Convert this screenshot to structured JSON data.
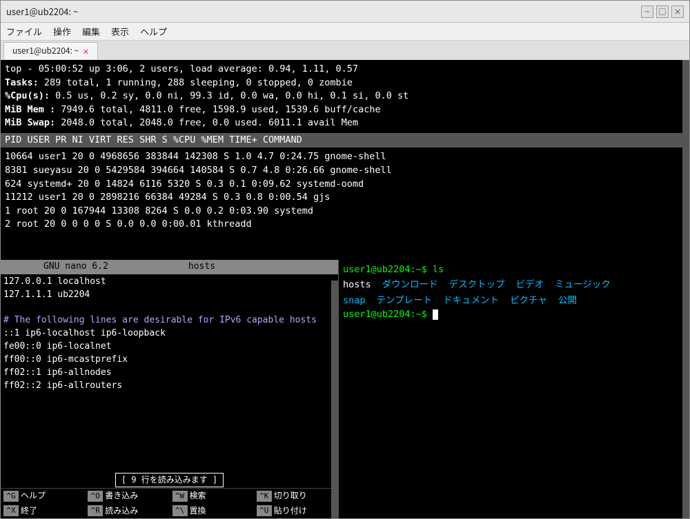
{
  "window": {
    "outer_title": "user1@ub2204: ~",
    "tab_title": "user1@ub2204: ~"
  },
  "menu": {
    "items": [
      "ファイル",
      "操作",
      "編集",
      "表示",
      "ヘルプ"
    ]
  },
  "top_output": {
    "line1": "top - 05:00:52 up  3:06,  2 users,  load average: 0.94, 1.11, 0.57",
    "line2_label": "Tasks:",
    "line2": " 289 total,   1 running, 288 sleeping,   0 stopped,   0 zombie",
    "line3_label": "%Cpu(s):",
    "line3": "  0.5 us,  0.2 sy,  0.0 ni, 99.3 id,  0.0 wa,  0.0 hi,  0.1 si,  0.0 st",
    "line4_label": "MiB Mem :",
    "line4": "  7949.6 total,   4811.0 free,   1598.9 used,   1539.6 buff/cache",
    "line5_label": "MiB Swap:",
    "line5": "  2048.0 total,   2048.0 free,      0.0 used.   6011.1 avail Mem",
    "table_header": "    PID USER      PR  NI    VIRT    RES    SHR S  %CPU  %MEM     TIME+ COMMAND",
    "rows": [
      "  10664 user1     20   0 4968656 383844 142308 S   1.0   4.7   0:24.75 gnome-shell",
      "   8381 sueyasu   20   0 5429584 394664 140584 S   0.7   4.8   0:26.66 gnome-shell",
      "    624 systemd+  20   0   14824   6116   5320 S   0.3   0.1   0:09.62 systemd-oomd",
      "  11212 user1     20   0 2898216  66384  49284 S   0.3   0.8   0:00.54 gjs",
      "      1 root      20   0  167944  13308   8264 S   0.0   0.2   0:03.90 systemd",
      "      2 root      20   0       0      0      0 S   0.0   0.0   0:00.01 kthreadd"
    ]
  },
  "nano": {
    "title_left": "GNU nano 6.2",
    "title_center": "hosts",
    "content_lines": [
      "127.0.0.1    localhost",
      "127.1.1.1    ub2204",
      "",
      "# The following lines are desirable for IPv6 capable hosts",
      "::1     ip6-localhost ip6-loopback",
      "fe00::0 ip6-localnet",
      "ff00::0 ip6-mcastprefix",
      "ff02::1 ip6-allnodes",
      "ff02::2 ip6-allrouters"
    ],
    "status_msg": "[ 9 行を読み込みます ]",
    "keys": [
      {
        "code": "^G",
        "label": "ヘルプ"
      },
      {
        "code": "^O",
        "label": "書き込み"
      },
      {
        "code": "^W",
        "label": "検索"
      },
      {
        "code": "^K",
        "label": "切り取り"
      },
      {
        "code": "^X",
        "label": "終了"
      },
      {
        "code": "^R",
        "label": "読み込み"
      },
      {
        "code": "^\\",
        "label": "置換"
      },
      {
        "code": "^U",
        "label": "貼り付け"
      }
    ]
  },
  "bash": {
    "prompt1": "user1@ub2204:~$ ls",
    "line1_files": [
      "hosts",
      "ダウンロード",
      "デスクトップ",
      "ビデオ",
      "ミュージック"
    ],
    "line2_files": [
      "snap",
      "テンプレート",
      "ドキュメント",
      "ピクチャ",
      "公開"
    ],
    "prompt2": "user1@ub2204:~$ "
  },
  "controls": {
    "minimize": "−",
    "restore": "□",
    "close": "×"
  }
}
